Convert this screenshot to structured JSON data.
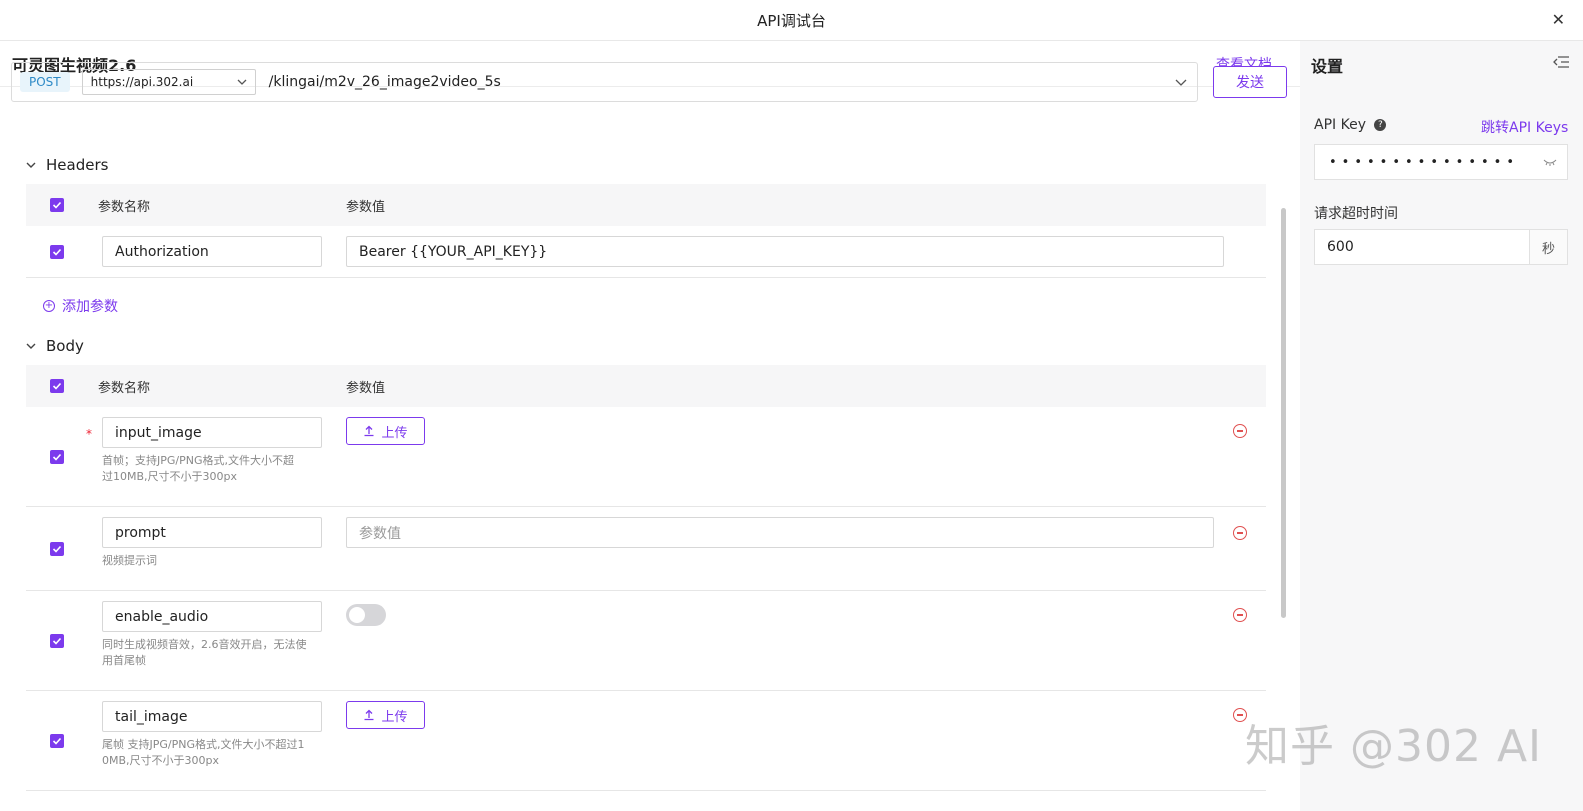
{
  "window": {
    "title": "API调试台",
    "close_glyph": "✕"
  },
  "panel": {
    "name": "可灵图生视频2.6",
    "doc_link": "查看文档"
  },
  "request": {
    "method": "POST",
    "base_url": "https://api.302.ai",
    "path": "/klingai/m2v_26_image2video_5s",
    "send_label": "发送"
  },
  "headers": {
    "title": "Headers",
    "col_name": "参数名称",
    "col_value": "参数值",
    "rows": [
      {
        "name": "Authorization",
        "value": "Bearer {{YOUR_API_KEY}}"
      }
    ],
    "add_label": "添加参数"
  },
  "body": {
    "title": "Body",
    "col_name": "参数名称",
    "col_value": "参数值",
    "rows": [
      {
        "name": "input_image",
        "required": "*",
        "desc_1": "首帧；支持JPG/PNG格式,文件大小不超",
        "desc_2": "过10MB,尺寸不小于300px",
        "upload_label": "上传"
      },
      {
        "name": "prompt",
        "placeholder": "参数值",
        "desc_1": "视频提示词"
      },
      {
        "name": "enable_audio",
        "toggle_on": false,
        "desc_1": "同时生成视频音效，2.6音效开启，无法使",
        "desc_2": "用首尾帧"
      },
      {
        "name": "tail_image",
        "desc_1": "尾帧 支持JPG/PNG格式,文件大小不超过1",
        "desc_2": "0MB,尺寸不小于300px",
        "upload_label": "上传"
      }
    ]
  },
  "settings": {
    "title": "设置",
    "api_key_label": "API Key",
    "api_key_link": "跳转API Keys",
    "api_key_masked": "•••••••••••••••",
    "timeout_label": "请求超时时间",
    "timeout_value": "600",
    "timeout_unit": "秒"
  },
  "watermark": "知乎 @302 AI",
  "colors": {
    "accent": "#7c3aed",
    "method_bg": "#e8f4fb",
    "method_text": "#2d8ac7",
    "danger": "#e05050"
  }
}
